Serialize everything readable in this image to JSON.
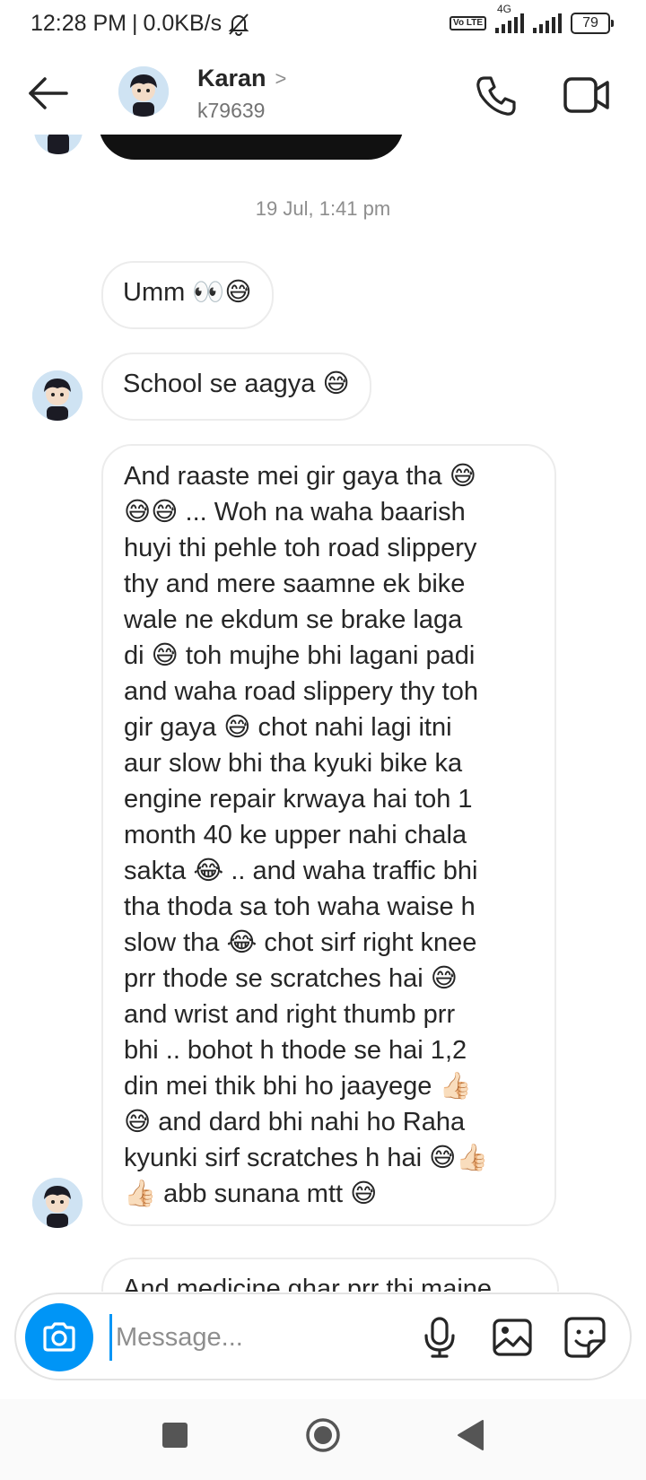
{
  "status_bar": {
    "time": "12:28 PM",
    "data_rate": "0.0KB/s",
    "network": "4G",
    "volte": "Vo LTE",
    "battery": "79"
  },
  "header": {
    "contact_name": "Karan",
    "chevron": ">",
    "username": "k79639"
  },
  "chat": {
    "timestamp": "19 Jul, 1:41 pm",
    "messages": [
      {
        "text": "Umm 👀😅"
      },
      {
        "text": "School se aagya 😅"
      },
      {
        "text": "And raaste mei gir gaya tha 😅\n😅😅 ... Woh na waha baarish\nhuyi thi pehle toh road slippery\nthy and mere saamne ek bike\nwale ne ekdum se brake laga\ndi 😅 toh mujhe bhi lagani padi\nand waha road slippery thy toh\ngir gaya 😅 chot nahi lagi itni\naur slow bhi tha kyuki bike ka\nengine repair krwaya hai toh 1\nmonth 40 ke upper nahi chala\nsakta 😂 .. and waha traffic bhi\ntha thoda sa toh waha waise h\nslow tha 😂 chot sirf right knee\nprr thode se scratches hai 😅\nand wrist and right thumb prr\nbhi .. bohot h thode se hai 1,2\ndin mei thik bhi ho jaayege 👍🏻\n😅 and dard bhi nahi ho Raha\nkyunki sirf scratches h hai 😅👍🏻\n👍🏻 abb sunana mtt  😅"
      },
      {
        "text": "And medicine ghar prr thi maine"
      }
    ]
  },
  "composer": {
    "placeholder": "Message..."
  },
  "icons": {
    "back": "arrow-left-icon",
    "call": "phone-icon",
    "video": "video-camera-icon",
    "camera": "camera-icon",
    "mic": "microphone-icon",
    "gallery": "image-icon",
    "sticker": "sticker-icon"
  },
  "colors": {
    "accent": "#0095f6",
    "bubble_border": "#ececec",
    "text": "#262626",
    "muted": "#8e8e8e"
  }
}
